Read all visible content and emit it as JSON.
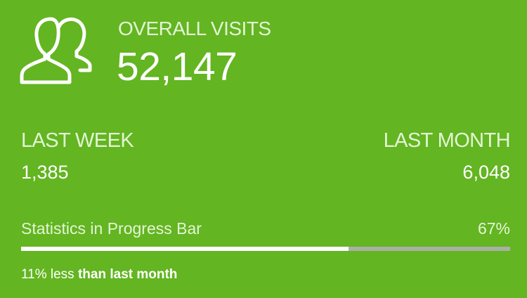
{
  "widget": {
    "icon": "users-icon",
    "overall_label": "OVERALL VISITS",
    "overall_value": "52,147",
    "background_color": "#63b521"
  },
  "stats": {
    "last_week_label": "LAST WEEK",
    "last_week_value": "1,385",
    "last_month_label": "LAST MONTH",
    "last_month_value": "6,048"
  },
  "progress": {
    "label": "Statistics in Progress Bar",
    "percent_text": "67%",
    "value": 0.67,
    "fill_color": "#ffffff",
    "track_color": "#a9b0a4"
  },
  "footnote": {
    "prefix": "11% less ",
    "emphasis": "than last month"
  }
}
